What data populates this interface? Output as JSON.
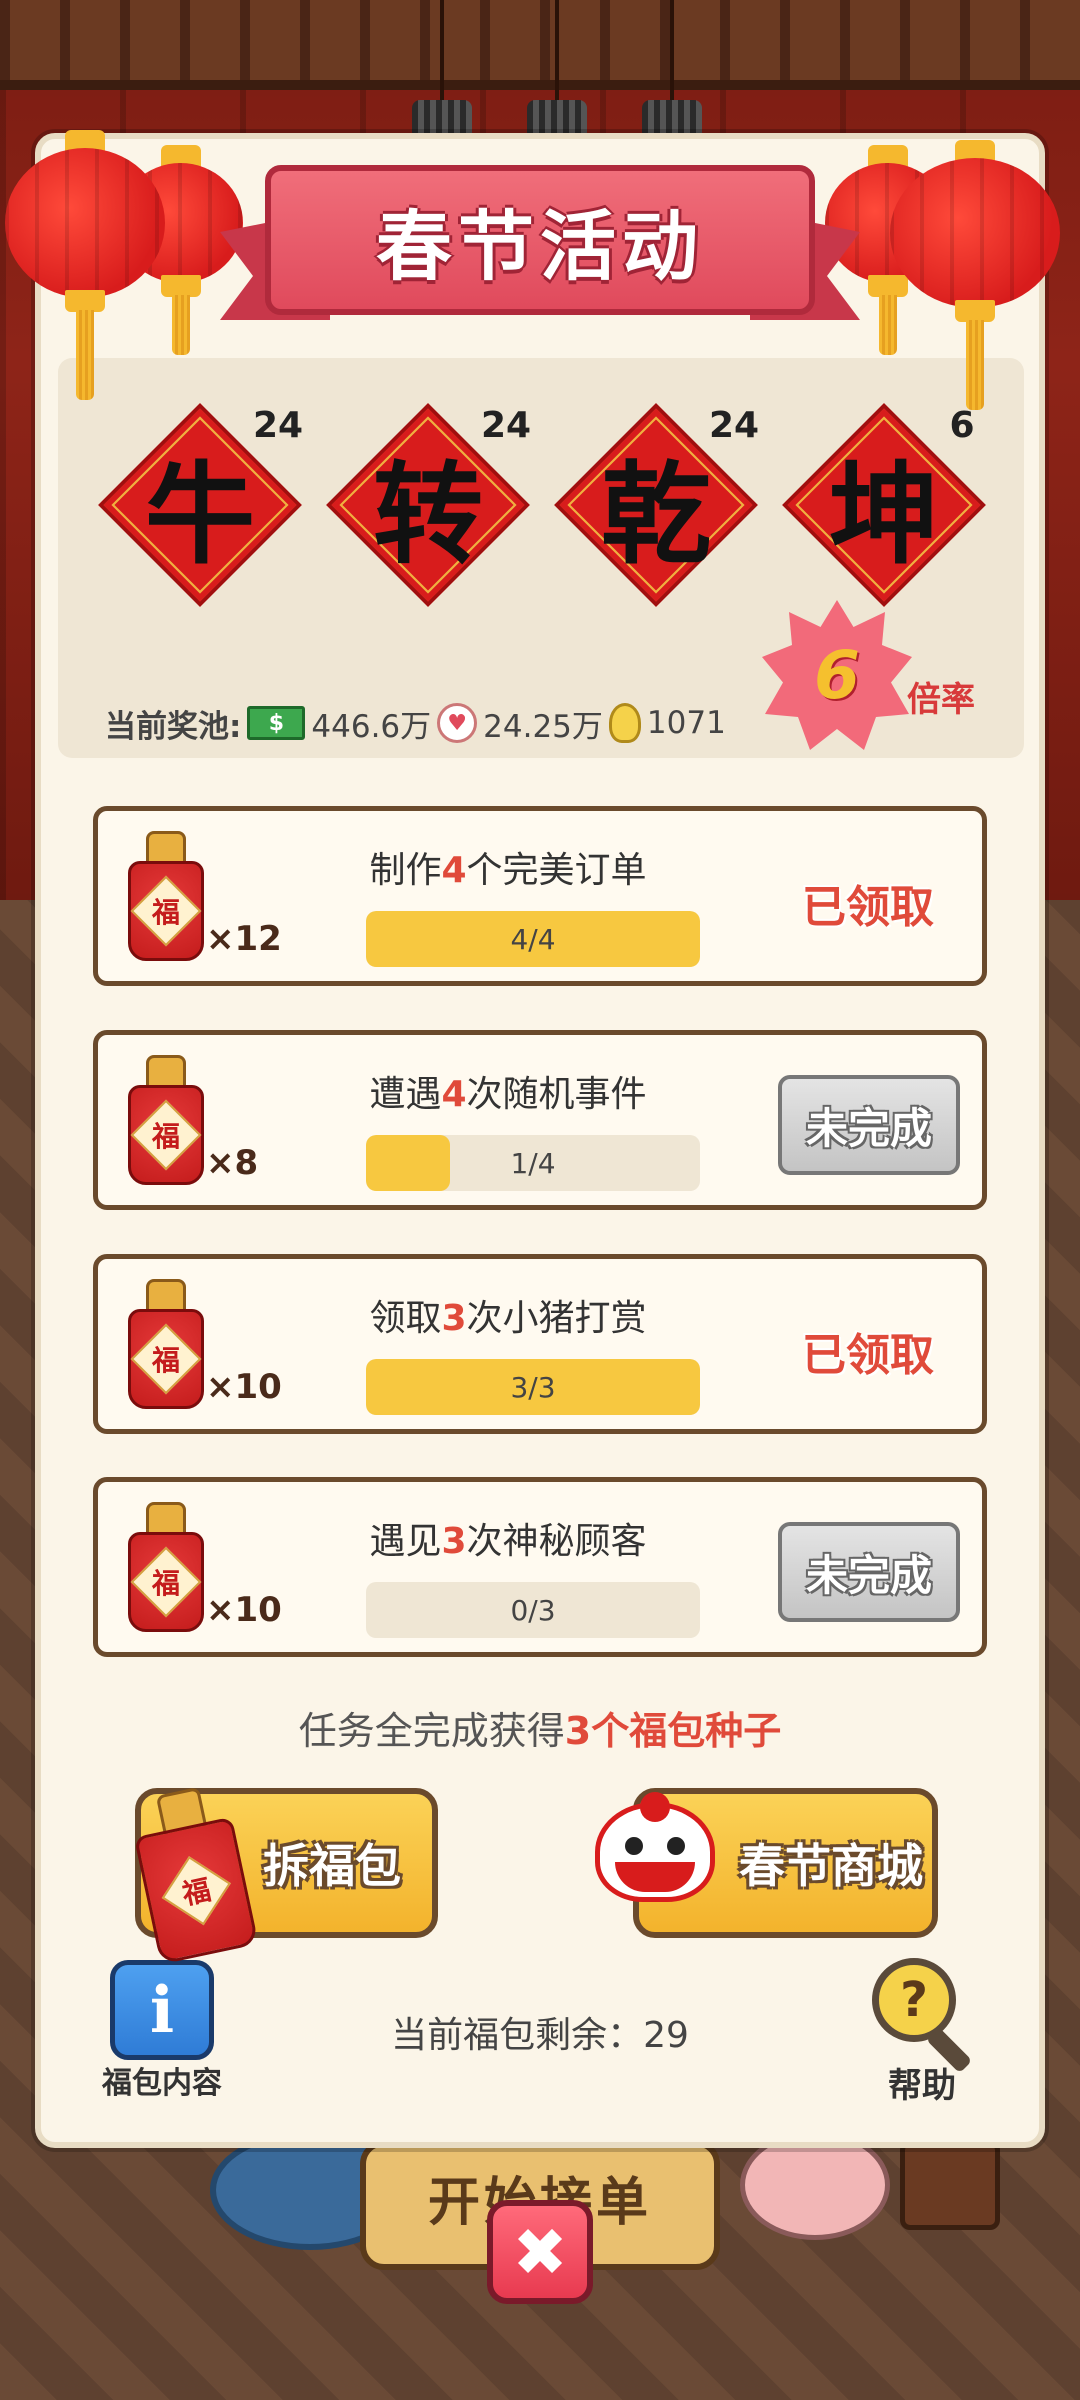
{
  "background": {
    "start_order_label": "开始接单"
  },
  "modal": {
    "title": "春节活动",
    "characters": [
      {
        "glyph": "牛",
        "count": "24"
      },
      {
        "glyph": "转",
        "count": "24"
      },
      {
        "glyph": "乾",
        "count": "24"
      },
      {
        "glyph": "坤",
        "count": "6"
      }
    ],
    "multiplier": {
      "value": "6",
      "label": "倍率"
    },
    "prize_pool": {
      "label": "当前奖池:",
      "cash_icon": "cash-icon",
      "cash_value": "446.6万",
      "heart_icon": "heart-icon",
      "heart_value": "24.25万",
      "bulb_icon": "bulb-icon",
      "bulb_value": "1071"
    },
    "tasks": [
      {
        "title_pre": "制作",
        "title_num": "4",
        "title_post": "个完美订单",
        "qty": "×12",
        "progress_text": "4/4",
        "progress": 1.0,
        "status": "已领取"
      },
      {
        "title_pre": "遭遇",
        "title_num": "4",
        "title_post": "次随机事件",
        "qty": "×8",
        "progress_text": "1/4",
        "progress": 0.25,
        "status": "未完成"
      },
      {
        "title_pre": "领取",
        "title_num": "3",
        "title_post": "次小猪打赏",
        "qty": "×10",
        "progress_text": "3/3",
        "progress": 1.0,
        "status": "已领取"
      },
      {
        "title_pre": "遇见",
        "title_num": "3",
        "title_post": "次神秘顾客",
        "qty": "×10",
        "progress_text": "0/3",
        "progress": 0.0,
        "status": "未完成"
      }
    ],
    "fu_glyph": "福",
    "complete_msg": {
      "pre": "任务全完成获得",
      "highlight": "3个福包种子"
    },
    "open_bag_label": "拆福包",
    "shop_label": "春节商城",
    "info_label": "福包内容",
    "remaining": "当前福包剩余：29",
    "help_label": "帮助",
    "help_glyph": "?",
    "info_glyph": "i",
    "close_glyph": "✖"
  },
  "colors": {
    "accent_red": "#e04a3a",
    "progress_fill": "#f7c840",
    "button_yellow": "#f3b32c",
    "modal_bg": "#fbf5e8"
  }
}
